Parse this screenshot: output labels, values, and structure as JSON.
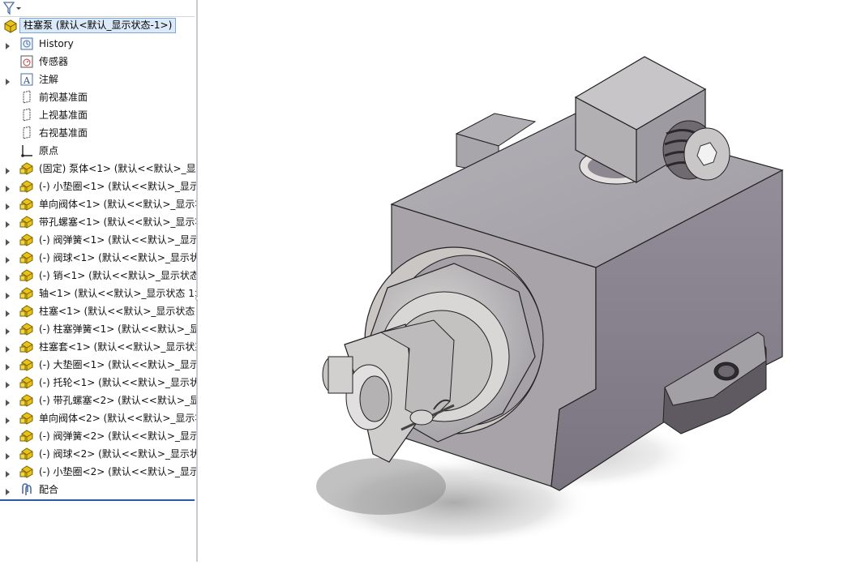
{
  "tree": {
    "root_label": "柱塞泵  (默认<默认_显示状态-1>)",
    "items": [
      {
        "label": "History",
        "icon": "history-icon",
        "expand": true
      },
      {
        "label": "传感器",
        "icon": "sensor-icon",
        "expand": false
      },
      {
        "label": "注解",
        "icon": "annotation-icon",
        "expand": true
      },
      {
        "label": "前视基准面",
        "icon": "plane-icon",
        "expand": false
      },
      {
        "label": "上视基准面",
        "icon": "plane-icon",
        "expand": false
      },
      {
        "label": "右视基准面",
        "icon": "plane-icon",
        "expand": false
      },
      {
        "label": "原点",
        "icon": "origin-icon",
        "expand": false
      },
      {
        "label": "(固定) 泵体<1> (默认<<默认>_显示",
        "icon": "part-icon",
        "expand": true
      },
      {
        "label": "(-) 小垫圈<1> (默认<<默认>_显示",
        "icon": "part-icon",
        "expand": true
      },
      {
        "label": "单向阀体<1> (默认<<默认>_显示状",
        "icon": "part-icon",
        "expand": true
      },
      {
        "label": "带孔螺塞<1> (默认<<默认>_显示状",
        "icon": "part-icon",
        "expand": true
      },
      {
        "label": "(-) 阀弹簧<1> (默认<<默认>_显示",
        "icon": "part-icon",
        "expand": true
      },
      {
        "label": "(-) 阀球<1> (默认<<默认>_显示状态",
        "icon": "part-icon",
        "expand": true
      },
      {
        "label": "(-) 销<1> (默认<<默认>_显示状态",
        "icon": "part-icon",
        "expand": true
      },
      {
        "label": "轴<1> (默认<<默认>_显示状态 1>",
        "icon": "part-icon",
        "expand": true
      },
      {
        "label": "柱塞<1> (默认<<默认>_显示状态 ·",
        "icon": "part-icon",
        "expand": true
      },
      {
        "label": "(-) 柱塞弹簧<1> (默认<<默认>_显",
        "icon": "part-icon",
        "expand": true
      },
      {
        "label": "柱塞套<1> (默认<<默认>_显示状态",
        "icon": "part-icon",
        "expand": true
      },
      {
        "label": "(-) 大垫圈<1> (默认<<默认>_显示",
        "icon": "part-icon",
        "expand": true
      },
      {
        "label": "(-) 托轮<1> (默认<<默认>_显示状",
        "icon": "part-icon",
        "expand": true
      },
      {
        "label": "(-) 带孔螺塞<2> (默认<<默认>_显",
        "icon": "part-icon",
        "expand": true
      },
      {
        "label": "单向阀体<2> (默认<<默认>_显示状",
        "icon": "part-icon",
        "expand": true
      },
      {
        "label": "(-) 阀弹簧<2> (默认<<默认>_显示",
        "icon": "part-icon",
        "expand": true
      },
      {
        "label": "(-) 阀球<2> (默认<<默认>_显示状",
        "icon": "part-icon",
        "expand": true
      },
      {
        "label": "(-) 小垫圈<2> (默认<<默认>_显示",
        "icon": "part-icon",
        "expand": true
      },
      {
        "label": "配合",
        "icon": "mates-icon",
        "expand": true
      }
    ]
  },
  "colors": {
    "part_yellow": "#e8c21a",
    "selection_bg": "#dbe9f9",
    "body_gray": "#8f8a96",
    "accent_blue": "#2a5aa6"
  }
}
